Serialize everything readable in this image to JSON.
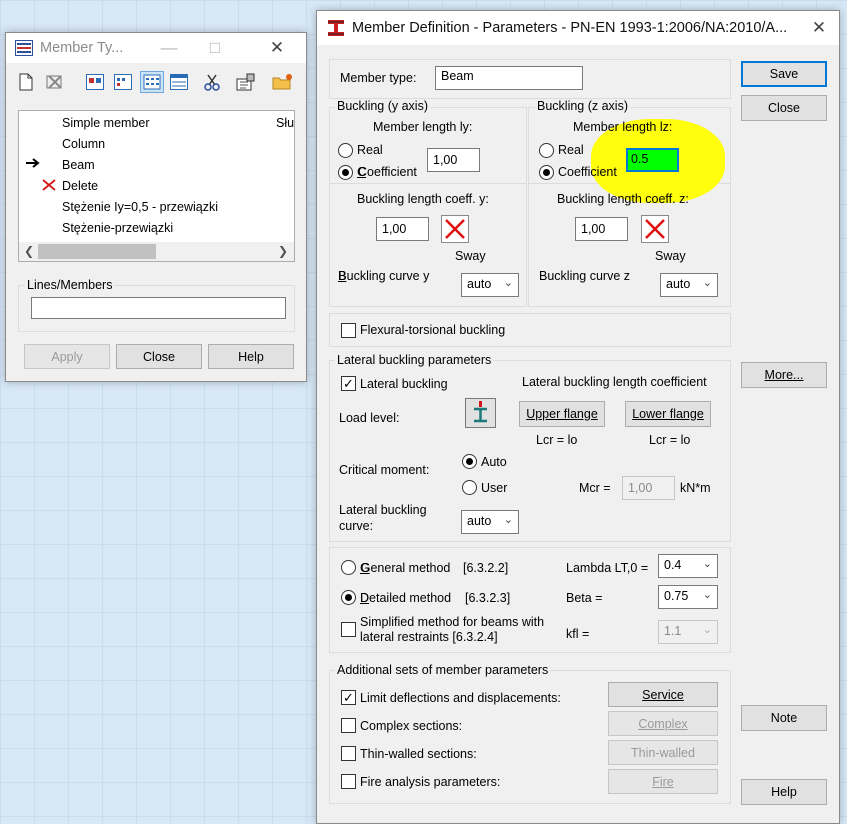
{
  "member_types_window": {
    "title": "Member Ty...",
    "list_items": [
      "Simple member",
      "Column",
      "Beam",
      "Delete",
      "Stężenie Iy=0,5 - przewiązki",
      "Stężenie-przewiązki"
    ],
    "overflow_text": "Słu",
    "lines_members_label": "Lines/Members",
    "lines_members_value": "",
    "apply_label": "Apply",
    "close_label": "Close",
    "help_label": "Help"
  },
  "main_dialog": {
    "title": "Member Definition - Parameters - PN-EN 1993-1:2006/NA:2010/A...",
    "member_type_label": "Member type:",
    "member_type_value": "Beam",
    "buttons": {
      "save": "Save",
      "close": "Close",
      "more": "More...",
      "note": "Note",
      "help": "Help"
    },
    "buckling_y": {
      "group_title": "Buckling (y axis)",
      "member_length_label": "Member length ly:",
      "real_label": "Real",
      "coefficient_label": "Coefficient",
      "length_value": "1,00",
      "coeff_label": "Buckling length coeff. y:",
      "coeff_value": "1,00",
      "sway_label": "Sway",
      "curve_label": "Buckling curve y",
      "curve_value": "auto"
    },
    "buckling_z": {
      "group_title": "Buckling (z axis)",
      "member_length_label": "Member length lz:",
      "real_label": "Real",
      "coefficient_label": "Coefficient",
      "length_value": "0.5",
      "coeff_label": "Buckling length coeff. z:",
      "coeff_value": "1,00",
      "sway_label": "Sway",
      "curve_label": "Buckling curve z",
      "curve_value": "auto"
    },
    "flexural_torsional_label": "Flexural-torsional buckling",
    "lateral": {
      "group_title": "Lateral buckling parameters",
      "lateral_buckling_label": "Lateral buckling",
      "coeff_heading": "Lateral buckling length coefficient",
      "load_level_label": "Load level:",
      "upper_flange": "Upper flange",
      "lower_flange": "Lower flange",
      "lcr_upper": "Lcr =  lo",
      "lcr_lower": "Lcr =  lo",
      "critical_moment_label": "Critical moment:",
      "auto_label": "Auto",
      "user_label": "User",
      "mcr_label": "Mcr =",
      "mcr_value": "1,00",
      "mcr_unit": "kN*m",
      "curve_label_1": "Lateral buckling",
      "curve_label_2": "curve:",
      "curve_value": "auto"
    },
    "methods": {
      "general_label": "General method",
      "general_ref": "[6.3.2.2]",
      "detailed_label": "Detailed method",
      "detailed_ref": "[6.3.2.3]",
      "simplified_label_1": "Simplified method for beams with",
      "simplified_label_2": "lateral restraints [6.3.2.4]",
      "lambda_label": "Lambda LT,0 =",
      "lambda_value": "0.4",
      "beta_label": "Beta =",
      "beta_value": "0.75",
      "kfl_label": "kfl =",
      "kfl_value": "1.1"
    },
    "additional": {
      "group_title": "Additional sets of member parameters",
      "limit_label": "Limit deflections and displacements:",
      "complex_label": "Complex sections:",
      "thin_label": "Thin-walled sections:",
      "fire_label": "Fire analysis parameters:",
      "service_btn": "Service",
      "complex_btn": "Complex",
      "thin_btn": "Thin-walled",
      "fire_btn": "Fire"
    }
  },
  "colors": {
    "highlight": "#ffff00",
    "active_field": "#00ff00",
    "accent": "#0078d7"
  }
}
